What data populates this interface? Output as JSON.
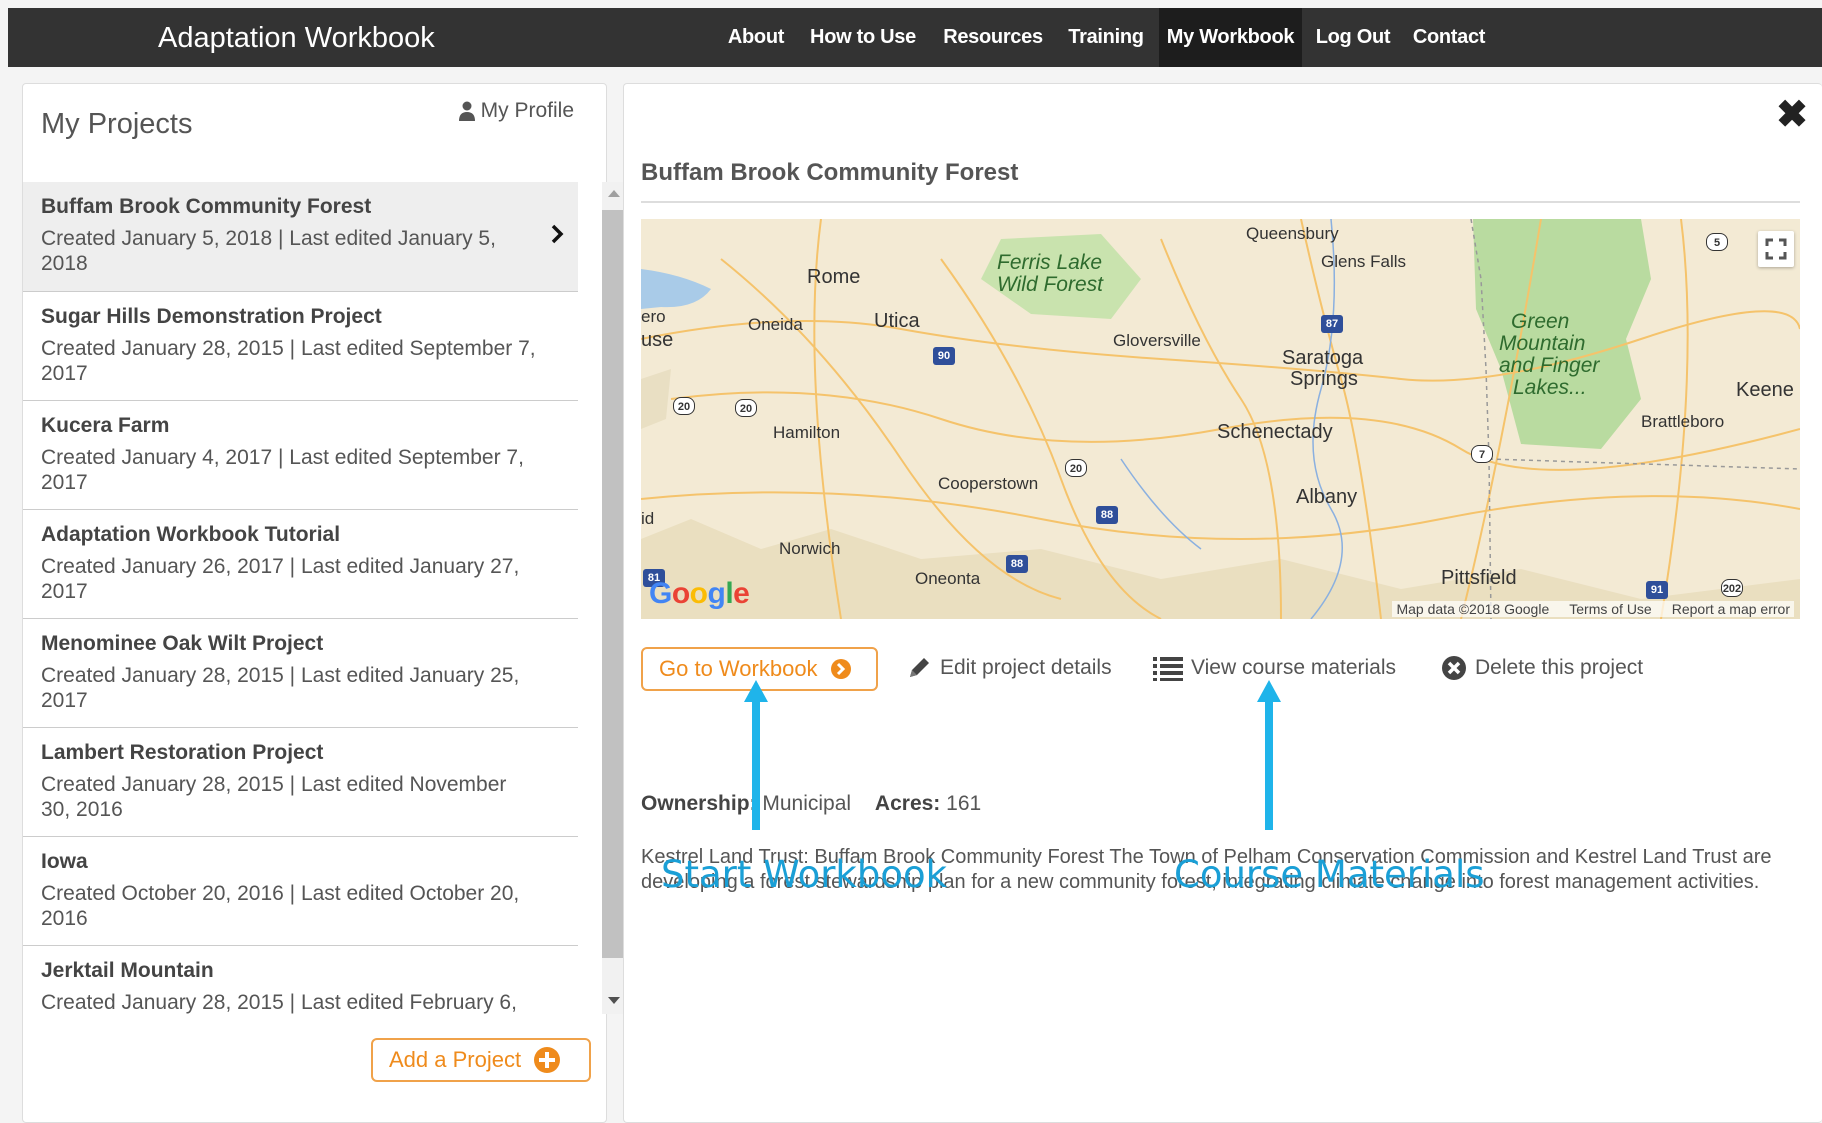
{
  "app": {
    "title": "Adaptation Workbook"
  },
  "nav": [
    {
      "label": "About",
      "active": false
    },
    {
      "label": "How to Use",
      "active": false
    },
    {
      "label": "Resources",
      "active": false
    },
    {
      "label": "Training",
      "active": false
    },
    {
      "label": "My Workbook",
      "active": true
    },
    {
      "label": "Log Out",
      "active": false
    },
    {
      "label": "Contact",
      "active": false
    }
  ],
  "sidebar": {
    "title": "My Projects",
    "profile_label": "My Profile",
    "profile_icon": "user-icon",
    "add_label": "Add a Project",
    "projects": [
      {
        "name": "Buffam Brook Community Forest",
        "dates": "Created January 5, 2018 | Last edited January 5, 2018",
        "selected": true
      },
      {
        "name": "Sugar Hills Demonstration Project",
        "dates": "Created January 28, 2015 | Last edited September 7, 2017",
        "selected": false
      },
      {
        "name": "Kucera Farm",
        "dates": "Created January 4, 2017 | Last edited September 7, 2017",
        "selected": false
      },
      {
        "name": "Adaptation Workbook Tutorial",
        "dates": "Created January 26, 2017 | Last edited January 27, 2017",
        "selected": false
      },
      {
        "name": "Menominee Oak Wilt Project",
        "dates": "Created January 28, 2015 | Last edited January 25, 2017",
        "selected": false
      },
      {
        "name": "Lambert Restoration Project",
        "dates": "Created January 28, 2015 | Last edited November 30, 2016",
        "selected": false
      },
      {
        "name": "Iowa",
        "dates": "Created October 20, 2016 | Last edited October 20, 2016",
        "selected": false
      },
      {
        "name": "Jerktail Mountain",
        "dates": "Created January 28, 2015 | Last edited February 6,",
        "selected": false
      }
    ]
  },
  "detail": {
    "title": "Buffam Brook Community Forest",
    "map": {
      "places": [
        "Queensbury",
        "Glens Falls",
        "Rome",
        "Ferris Lake",
        "Wild Forest",
        "Oneida",
        "Utica",
        "Gloversville",
        "Saratoga",
        "Springs",
        "Green",
        "Mountain",
        "and Finger",
        "Lakes...",
        "Keene",
        "Brattleboro",
        "Hamilton",
        "Schenectady",
        "Cooperstown",
        "Albany",
        "Norwich",
        "Oneonta",
        "Pittsfield",
        "ero",
        "use",
        "id"
      ],
      "shields": [
        "5",
        "87",
        "90",
        "20",
        "20",
        "20",
        "7",
        "88",
        "88",
        "81",
        "91",
        "202"
      ],
      "google": "Google",
      "map_data": "Map data ©2018 Google",
      "terms": "Terms of Use",
      "report": "Report a map error"
    },
    "actions": {
      "go_workbook": "Go to Workbook",
      "edit": "Edit project details",
      "view": "View course materials",
      "delete": "Delete this project"
    },
    "ownership_label": "Ownership:",
    "ownership_value": "Municipal",
    "acres_label": "Acres:",
    "acres_value": "161",
    "description": "Kestrel Land Trust: Buffam Brook Community Forest The Town of Pelham Conservation Commission and Kestrel Land Trust are developing a forest stewardship plan for a new community forest, integrating climate change into forest management activities."
  },
  "annotations": {
    "start": "Start Workbook",
    "course": "Course Materials"
  },
  "colors": {
    "accent_orange": "#ef8b1c",
    "annotation_blue": "#1a9fd6",
    "nav_bg": "#333333"
  }
}
